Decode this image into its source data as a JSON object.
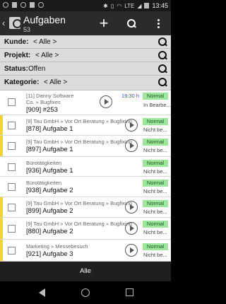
{
  "status_bar": {
    "time": "13:45",
    "left_icons": [
      "whatsapp-icon",
      "instagram-icon",
      "messenger-icon",
      "app-icon",
      "notification-icon"
    ],
    "right_icons": [
      "bluetooth-icon",
      "vibrate-icon",
      "wifi-icon",
      "signal-icon",
      "battery-icon"
    ],
    "network": "LTE"
  },
  "app_bar": {
    "title": "Aufgaben",
    "count": "53",
    "actions": [
      "add-icon",
      "search-icon",
      "more-icon"
    ]
  },
  "filters": [
    {
      "label": "Kunde:",
      "value": "< Alle >"
    },
    {
      "label": "Projekt:",
      "value": "< Alle >"
    },
    {
      "label": "Status:",
      "value": "Offen"
    },
    {
      "label": "Kategorie:",
      "value": "< Alle >"
    }
  ],
  "tasks": [
    {
      "context": "[11] Danny Software Co. » Bugfixes",
      "title": "[909] #253",
      "time": "19:30 h",
      "priority": "Normal",
      "status": "In Bearbe...",
      "bar_color": "#ffffff"
    },
    {
      "context": "[9] Tau GmbH » Vor Ort Beratung » Bugfixing",
      "title": "[878] Aufgabe 1",
      "time": "",
      "priority": "Normal",
      "status": "Nicht be...",
      "bar_color": "#f2d23a"
    },
    {
      "context": "[9] Tau GmbH » Vor Ort Beratung » Bugfixing",
      "title": "[897] Aufgabe 1",
      "time": "",
      "priority": "Normal",
      "status": "Nicht be...",
      "bar_color": "#f2d23a"
    },
    {
      "context": "Bürotätigkeiten",
      "title": "[936] Aufgabe 1",
      "time": "",
      "priority": "Normal",
      "status": "Nicht be...",
      "bar_color": "#ffffff"
    },
    {
      "context": "Bürotätigkeiten",
      "title": "[938] Aufgabe 2",
      "time": "",
      "priority": "Normal",
      "status": "Nicht be...",
      "bar_color": "#ffffff"
    },
    {
      "context": "[9] Tau GmbH » Vor Ort Beratung » Bugfixing",
      "title": "[899] Aufgabe 2",
      "time": "",
      "priority": "Normal",
      "status": "Nicht be...",
      "bar_color": "#f2d23a"
    },
    {
      "context": "[9] Tau GmbH » Vor Ort Beratung » Bugfixing",
      "title": "[880] Aufgabe 2",
      "time": "",
      "priority": "Normal",
      "status": "Nicht be...",
      "bar_color": "#f2d23a"
    },
    {
      "context": "Marketing » Messebesuch",
      "title": "[921] Aufgabe 3",
      "time": "",
      "priority": "Normal",
      "status": "Nicht be...",
      "bar_color": "#f2d23a"
    }
  ],
  "bottom_bar": {
    "label": "Alle"
  },
  "colors": {
    "priority_bg": "#9ee59e",
    "accent_bar": "#f2d23a",
    "time_text": "#1e5fc4"
  }
}
